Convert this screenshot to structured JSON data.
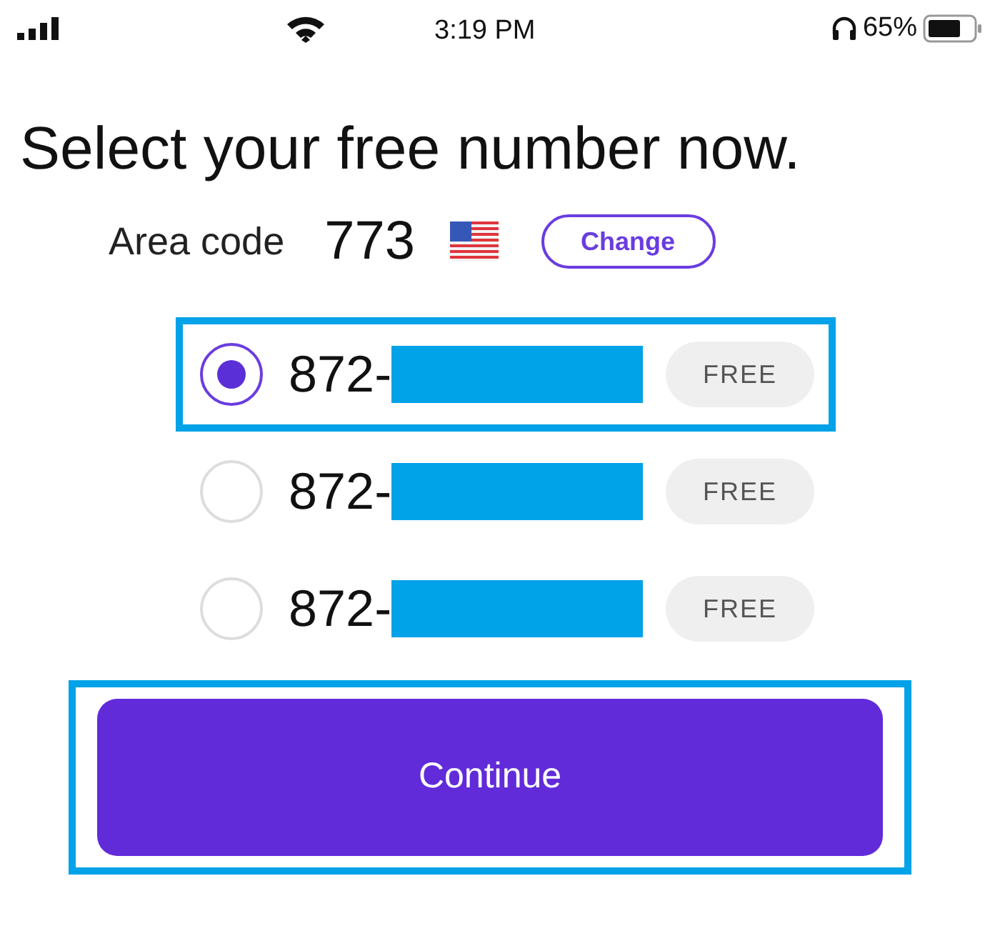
{
  "status_bar": {
    "time": "3:19 PM",
    "battery": "65%"
  },
  "title": "Select your free number now.",
  "area_code": {
    "label": "Area code",
    "value": "773",
    "button": "Change"
  },
  "numbers": [
    {
      "prefix": "872-",
      "badge": "FREE",
      "selected": true,
      "highlighted": true
    },
    {
      "prefix": "872-",
      "badge": "FREE",
      "selected": false,
      "highlighted": false
    },
    {
      "prefix": "872-",
      "badge": "FREE",
      "selected": false,
      "highlighted": false
    }
  ],
  "continue": {
    "label": "Continue",
    "highlighted": true
  }
}
